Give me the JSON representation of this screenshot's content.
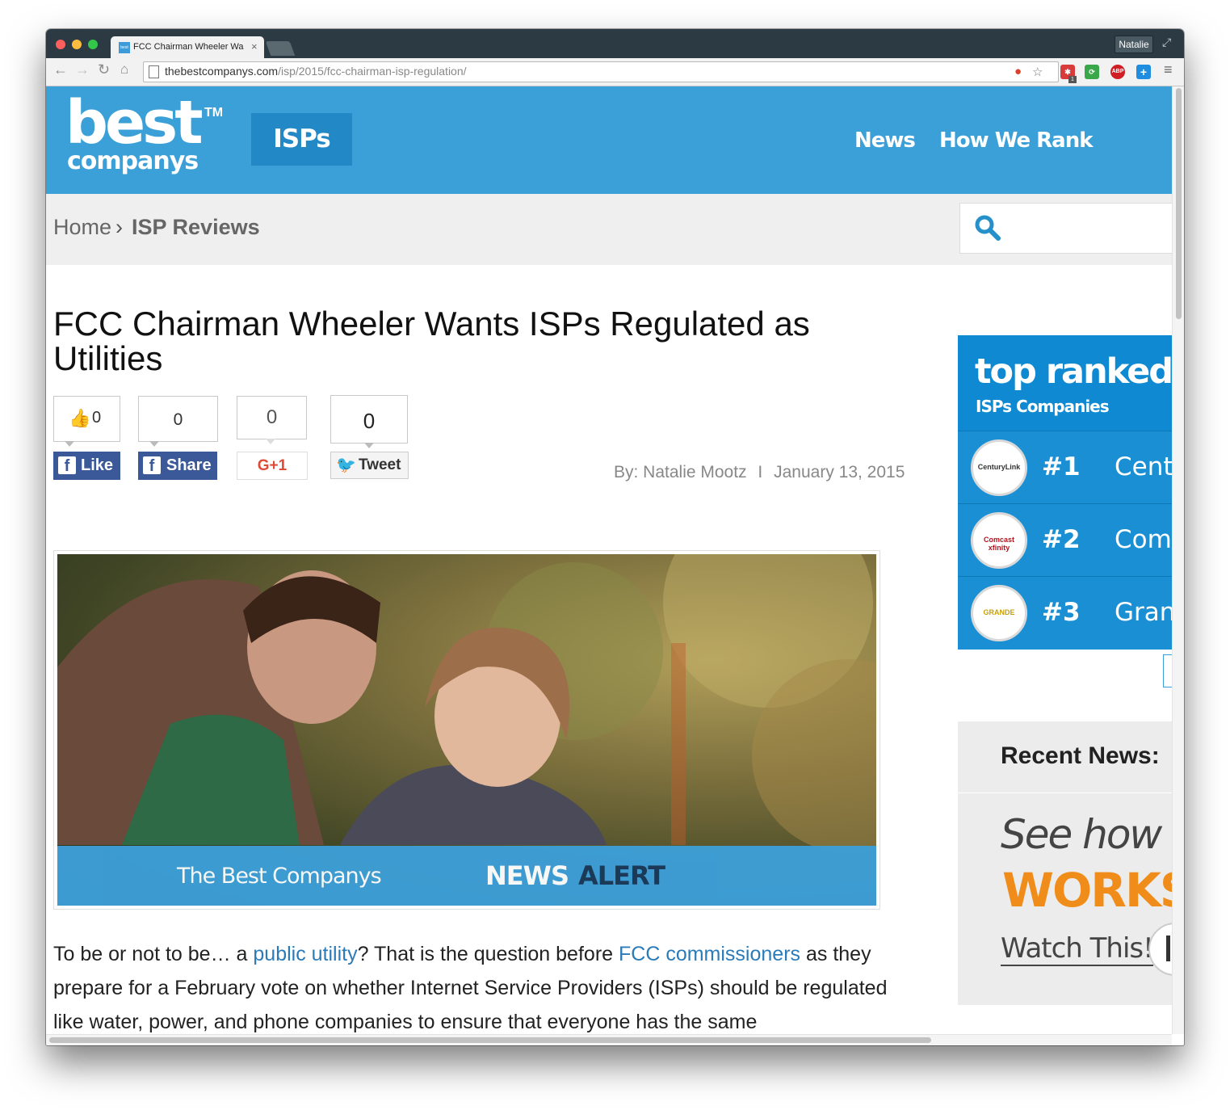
{
  "browser": {
    "tab_title": "FCC Chairman Wheeler Wa",
    "tab_favicon_text": "best",
    "profile_name": "Natalie",
    "url_host": "thebestcompanys.com",
    "url_path": "/isp/2015/fcc-chairman-isp-regulation/",
    "icons": [
      "back-icon",
      "forward-icon",
      "reload-icon",
      "home-icon",
      "page-icon",
      "lastpass-icon",
      "star-icon",
      "extension-icon",
      "evernote-icon",
      "adblock-icon",
      "plus-icon",
      "menu-icon"
    ],
    "ext_badge": "1",
    "adblock_label": "ABP",
    "traffic_lights": [
      "#fc605c",
      "#fdbc40",
      "#34c84a"
    ]
  },
  "header": {
    "logo_best": "best",
    "logo_tm": "TM",
    "logo_companys": "companys",
    "section_button": "ISPs",
    "nav": [
      "News",
      "How We Rank"
    ],
    "brand_color": "#3ca0d8"
  },
  "breadcrumb": {
    "home": "Home",
    "separator": "›",
    "current": "ISP Reviews"
  },
  "search": {
    "icon": "search-icon"
  },
  "article": {
    "title": "FCC Chairman Wheeler Wants ISPs Regulated as Utilities",
    "byline_author": "By: Natalie Mootz",
    "byline_sep": "I",
    "byline_date": "January 13, 2015",
    "social": {
      "fb_like_count": "0",
      "fb_like_label": "Like",
      "fb_share_count": "0",
      "fb_share_label": "Share",
      "gplus_count": "0",
      "gplus_label": "G+1",
      "tweet_count": "0",
      "tweet_label": "Tweet"
    },
    "hero": {
      "banner_left": "The Best Companys",
      "banner_news": "NEWS",
      "banner_alert": "ALERT"
    },
    "body": {
      "p1": "To be or not to be… a ",
      "link1": "public utility",
      "p2": "? That is the question before ",
      "link2": "FCC commissioners",
      "p3": " as they prepare for a February vote on whether Internet Service Providers (ISPs) should be regulated like water, power, and phone companies to ensure that everyone has the same"
    }
  },
  "sidebar": {
    "top_ranked": {
      "title": "top ranked",
      "subtitle": "ISPs Companies",
      "rows": [
        {
          "rank": "#1",
          "name": "CenturyLink",
          "logo": "CenturyLink"
        },
        {
          "rank": "#2",
          "name": "Comcast",
          "logo": "Comcast xfinity"
        },
        {
          "rank": "#3",
          "name": "Grande",
          "logo": "GRANDE"
        }
      ]
    },
    "recent_news": {
      "title": "Recent News:"
    },
    "ad": {
      "line1": "See how",
      "line2": "WORKS",
      "line3": "Watch This!"
    }
  }
}
